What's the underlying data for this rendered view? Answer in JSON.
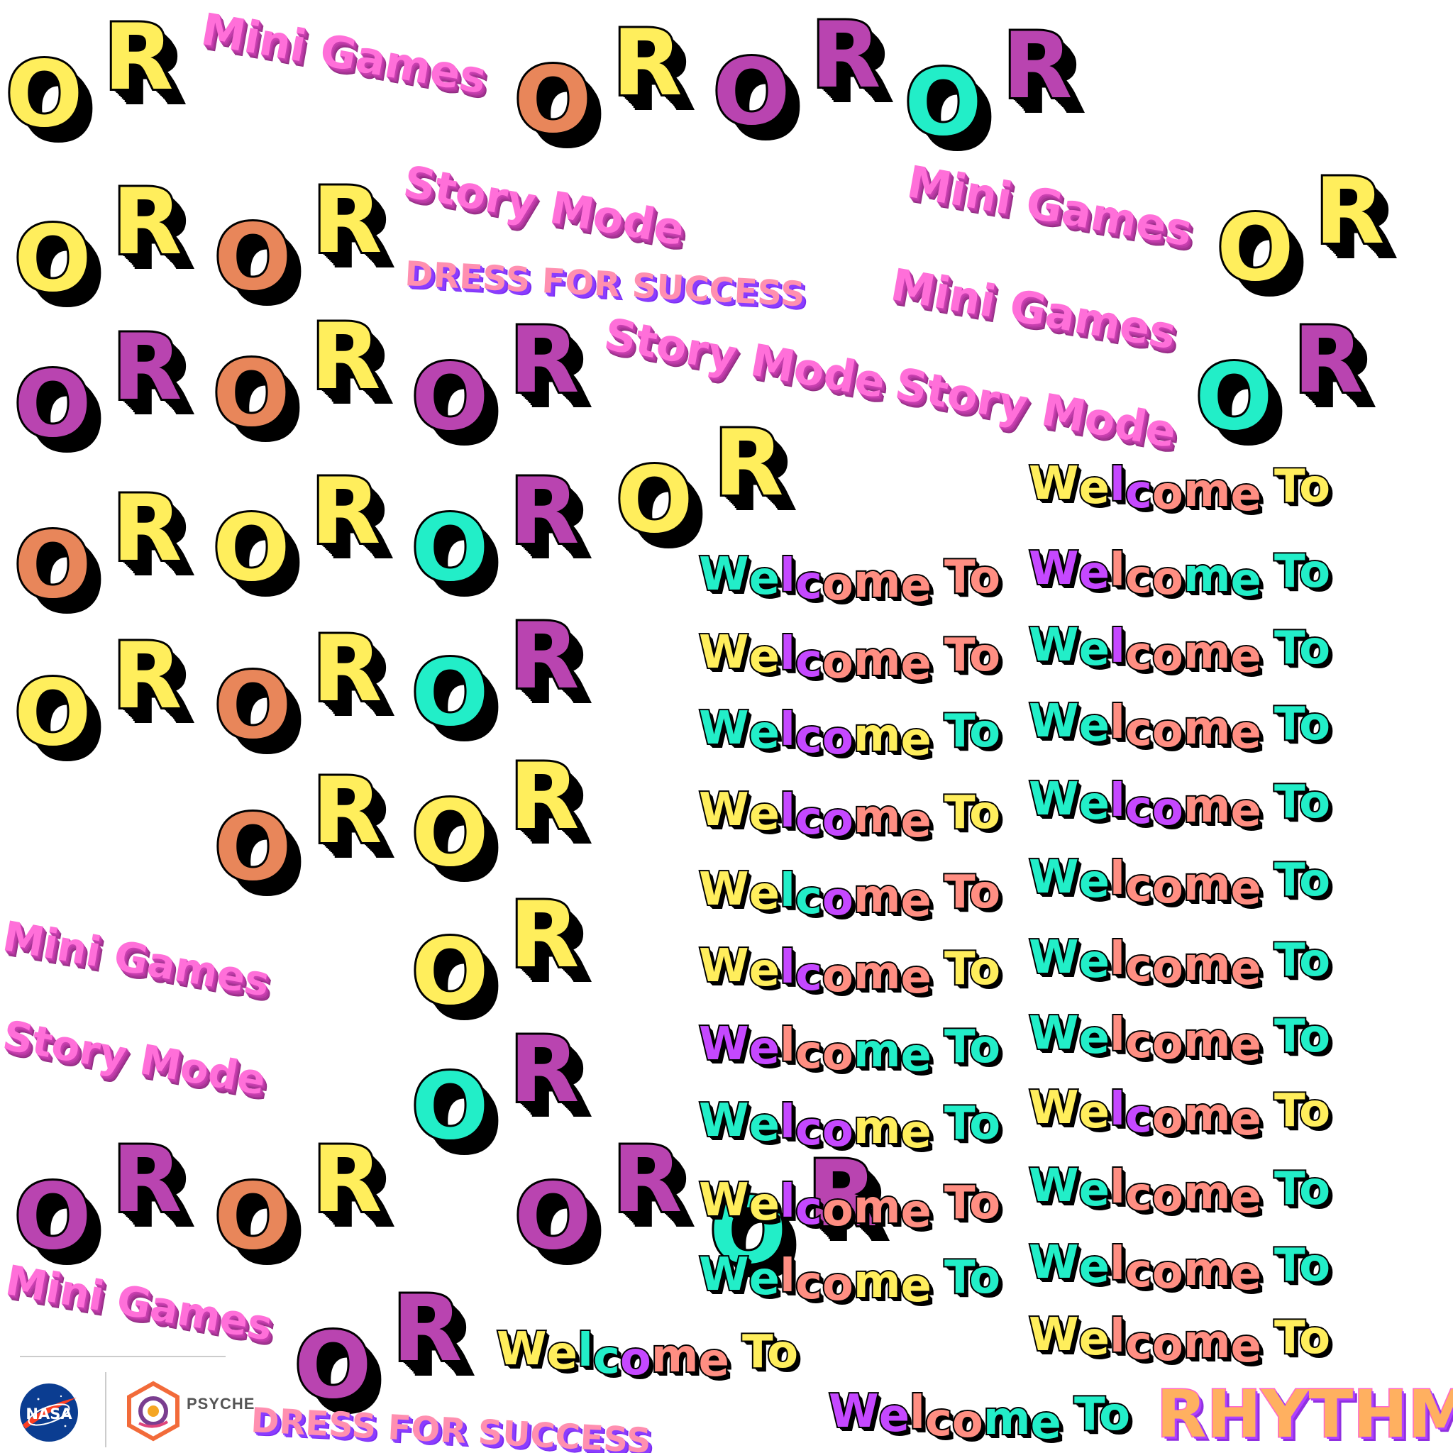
{
  "tokens": {
    "or_o": "O",
    "or_r": "R",
    "mini_games": "Mini Games",
    "story_mode": "Story Mode",
    "dress_for_success": "DRESS FOR SUCCESS",
    "welcome_letters": [
      "W",
      "e",
      "l",
      "c",
      "o",
      "m",
      "e"
    ],
    "to": "To",
    "rhythm": "RHYTHM"
  },
  "colors": {
    "yellow": "#ffee5c",
    "orange": "#e8865a",
    "purple": "#b944b0",
    "cyan": "#22eec8",
    "violet": "#c548ff",
    "salmon": "#ff8e82",
    "pink": "#ff6fd9",
    "black": "#000000"
  },
  "or_tiles": [
    {
      "o": "yellow",
      "r": "yellow"
    },
    {
      "o": "orange",
      "r": "yellow"
    },
    {
      "o": "purple",
      "r": "purple"
    },
    {
      "o": "cyan",
      "r": "purple"
    },
    {
      "o": "yellow",
      "r": "yellow"
    },
    {
      "o": "orange",
      "r": "yellow"
    },
    {
      "o": "yellow",
      "r": "yellow"
    },
    {
      "o": "purple",
      "r": "purple"
    },
    {
      "o": "orange",
      "r": "yellow"
    },
    {
      "o": "purple",
      "r": "purple"
    },
    {
      "o": "cyan",
      "r": "purple"
    },
    {
      "o": "yellow",
      "r": "yellow"
    },
    {
      "o": "orange",
      "r": "yellow"
    },
    {
      "o": "yellow",
      "r": "yellow"
    },
    {
      "o": "cyan",
      "r": "purple"
    },
    {
      "o": "yellow",
      "r": "yellow"
    },
    {
      "o": "orange",
      "r": "yellow"
    },
    {
      "o": "cyan",
      "r": "purple"
    },
    {
      "o": "orange",
      "r": "yellow"
    },
    {
      "o": "yellow",
      "r": "yellow"
    },
    {
      "o": "yellow",
      "r": "yellow"
    },
    {
      "o": "cyan",
      "r": "purple"
    },
    {
      "o": "purple",
      "r": "purple"
    },
    {
      "o": "orange",
      "r": "yellow"
    },
    {
      "o": "cyan",
      "r": "purple"
    },
    {
      "o": "purple",
      "r": "purple"
    },
    {
      "o": "purple",
      "r": "purple"
    }
  ],
  "pink_labels": [
    "mini_games",
    "story_mode",
    "mini_games",
    "mini_games",
    "story_mode",
    "story_mode",
    "mini_games",
    "story_mode",
    "mini_games"
  ],
  "dress_labels": [
    "dress_for_success",
    "dress_for_success"
  ],
  "welcome_palettes": [
    [
      "yellow",
      "yellow",
      "violet",
      "violet",
      "salmon",
      "salmon",
      "salmon",
      "yellow"
    ],
    [
      "cyan",
      "cyan",
      "violet",
      "violet",
      "salmon",
      "salmon",
      "salmon",
      "salmon"
    ],
    [
      "violet",
      "violet",
      "salmon",
      "salmon",
      "salmon",
      "cyan",
      "cyan",
      "cyan"
    ],
    [
      "yellow",
      "yellow",
      "violet",
      "violet",
      "salmon",
      "salmon",
      "salmon",
      "salmon"
    ],
    [
      "cyan",
      "cyan",
      "violet",
      "salmon",
      "salmon",
      "salmon",
      "salmon",
      "cyan"
    ],
    [
      "cyan",
      "cyan",
      "violet",
      "violet",
      "violet",
      "yellow",
      "yellow",
      "cyan"
    ],
    [
      "cyan",
      "cyan",
      "salmon",
      "salmon",
      "salmon",
      "salmon",
      "salmon",
      "cyan"
    ],
    [
      "yellow",
      "yellow",
      "violet",
      "violet",
      "violet",
      "salmon",
      "salmon",
      "yellow"
    ],
    [
      "cyan",
      "cyan",
      "violet",
      "violet",
      "violet",
      "salmon",
      "salmon",
      "cyan"
    ],
    [
      "yellow",
      "yellow",
      "cyan",
      "cyan",
      "violet",
      "salmon",
      "salmon",
      "salmon"
    ],
    [
      "cyan",
      "cyan",
      "salmon",
      "salmon",
      "salmon",
      "salmon",
      "salmon",
      "cyan"
    ],
    [
      "yellow",
      "yellow",
      "violet",
      "violet",
      "salmon",
      "salmon",
      "salmon",
      "yellow"
    ],
    [
      "cyan",
      "cyan",
      "salmon",
      "salmon",
      "salmon",
      "salmon",
      "salmon",
      "cyan"
    ],
    [
      "violet",
      "violet",
      "salmon",
      "salmon",
      "salmon",
      "cyan",
      "cyan",
      "cyan"
    ],
    [
      "cyan",
      "cyan",
      "salmon",
      "salmon",
      "salmon",
      "salmon",
      "salmon",
      "cyan"
    ],
    [
      "cyan",
      "cyan",
      "violet",
      "violet",
      "violet",
      "yellow",
      "yellow",
      "cyan"
    ],
    [
      "yellow",
      "yellow",
      "violet",
      "violet",
      "salmon",
      "salmon",
      "salmon",
      "yellow"
    ],
    [
      "yellow",
      "yellow",
      "violet",
      "violet",
      "salmon",
      "salmon",
      "salmon",
      "salmon"
    ],
    [
      "cyan",
      "cyan",
      "salmon",
      "salmon",
      "salmon",
      "salmon",
      "salmon",
      "cyan"
    ],
    [
      "cyan",
      "cyan",
      "salmon",
      "salmon",
      "salmon",
      "yellow",
      "yellow",
      "cyan"
    ],
    [
      "cyan",
      "cyan",
      "salmon",
      "salmon",
      "salmon",
      "salmon",
      "salmon",
      "cyan"
    ],
    [
      "yellow",
      "yellow",
      "salmon",
      "salmon",
      "salmon",
      "salmon",
      "salmon",
      "yellow"
    ],
    [
      "yellow",
      "yellow",
      "cyan",
      "cyan",
      "violet",
      "salmon",
      "salmon",
      "yellow"
    ],
    [
      "violet",
      "violet",
      "salmon",
      "salmon",
      "salmon",
      "cyan",
      "cyan",
      "cyan"
    ]
  ],
  "footer": {
    "nasa_text": "NASA",
    "psyche_text": "PSYCHE"
  }
}
